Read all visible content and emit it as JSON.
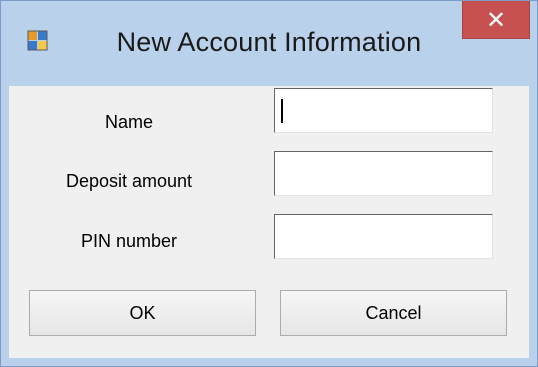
{
  "window": {
    "title": "New Account Information",
    "close_glyph": "✕",
    "icon": "app-window-icon",
    "colors": {
      "frame": "#b9d1ea",
      "close": "#c75050",
      "client": "#f0f0f0"
    }
  },
  "form": {
    "fields": [
      {
        "label": "Name",
        "value": ""
      },
      {
        "label": "Deposit amount",
        "value": ""
      },
      {
        "label": "PIN number",
        "value": ""
      }
    ]
  },
  "buttons": {
    "ok_label": "OK",
    "cancel_label": "Cancel"
  }
}
